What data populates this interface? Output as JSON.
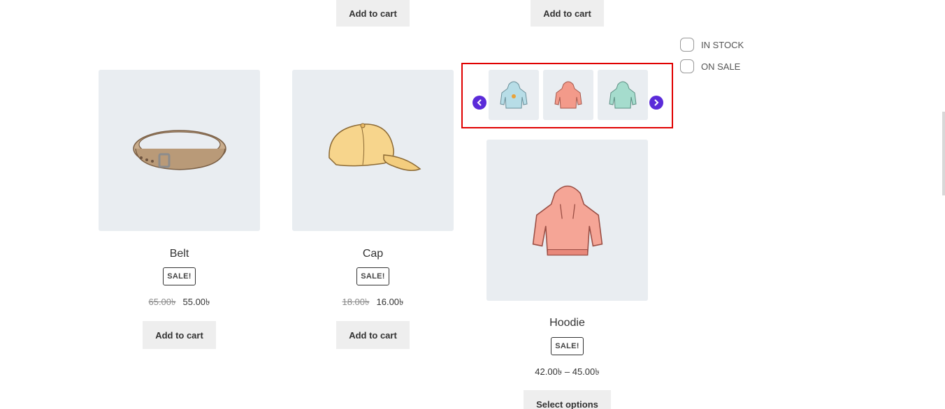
{
  "top_buttons": [
    {
      "label": "Add to cart"
    },
    {
      "label": "Add to cart"
    }
  ],
  "filters": [
    {
      "label": "IN STOCK"
    },
    {
      "label": "ON SALE"
    }
  ],
  "carousel": {
    "prev_icon": "chevron-left-icon",
    "next_icon": "chevron-right-icon",
    "accent_color": "#5b2bd9",
    "highlight_color": "#e00000",
    "thumbnails": [
      {
        "icon": "hoodie-blue-logo-icon"
      },
      {
        "icon": "hoodie-pink-icon"
      },
      {
        "icon": "hoodie-green-icon"
      }
    ]
  },
  "products": [
    {
      "title": "Belt",
      "badge": "SALE!",
      "old_price": "65.00৳",
      "price": "55.00৳",
      "button": "Add to cart",
      "icon": "belt-icon"
    },
    {
      "title": "Cap",
      "badge": "SALE!",
      "old_price": "18.00৳",
      "price": "16.00৳",
      "button": "Add to cart",
      "icon": "cap-icon"
    },
    {
      "title": "Hoodie",
      "badge": "SALE!",
      "price_range": "42.00৳ – 45.00৳",
      "button": "Select options",
      "icon": "hoodie-icon"
    }
  ]
}
